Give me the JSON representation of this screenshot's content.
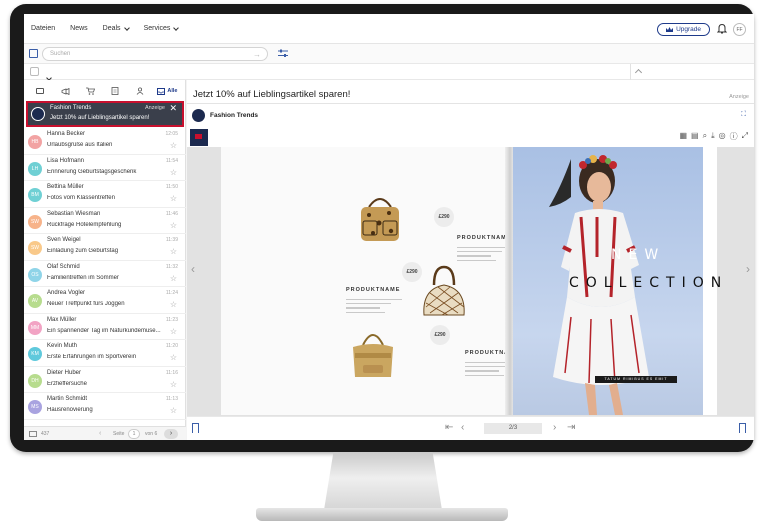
{
  "topnav": {
    "items": [
      {
        "label": "Dateien",
        "has_menu": false
      },
      {
        "label": "News",
        "has_menu": false
      },
      {
        "label": "Deals",
        "has_menu": true
      },
      {
        "label": "Services",
        "has_menu": true
      }
    ],
    "upgrade_label": "Upgrade",
    "user_initials": "FF"
  },
  "search": {
    "placeholder": "Suchen"
  },
  "list_tabs": {
    "all_label": "Alle"
  },
  "selected_ad": {
    "name": "Fashion Trends",
    "tag": "Anzeige",
    "subject": "Jetzt 10% auf Lieblingsartikel sparen!"
  },
  "mails": [
    {
      "initials": "HB",
      "name": "Hanna Becker",
      "subject": "Urlaubsgrüße aus Italien",
      "time": "12:05",
      "color": "#f2a3a3"
    },
    {
      "initials": "LH",
      "name": "Lisa Hofmann",
      "subject": "Erinnerung Geburtstagsgeschenk",
      "time": "11:54",
      "color": "#6fd0d4"
    },
    {
      "initials": "BM",
      "name": "Bettina Müller",
      "subject": "Fotos vom Klassentreffen",
      "time": "11:50",
      "color": "#6fd0d4"
    },
    {
      "initials": "SW",
      "name": "Sebastian Wiesman",
      "subject": "Rückfrage Hotelempfehlung",
      "time": "11:46",
      "color": "#f7b38a"
    },
    {
      "initials": "SW",
      "name": "Sven Weigel",
      "subject": "Einladung zum Geburtstag",
      "time": "11:39",
      "color": "#f9c98a"
    },
    {
      "initials": "OS",
      "name": "Olaf Schmid",
      "subject": "Familientreffen im Sommer",
      "time": "11:32",
      "color": "#8fd4e8"
    },
    {
      "initials": "AV",
      "name": "Andrea Vogler",
      "subject": "Neuer Treffpunkt fürs Joggen",
      "time": "11:24",
      "color": "#b7dc8e"
    },
    {
      "initials": "MM",
      "name": "Max Müller",
      "subject": "Ein spannender Tag im Naturkundemuse...",
      "time": "11:23",
      "color": "#f2a3c4"
    },
    {
      "initials": "KM",
      "name": "Kevin Muth",
      "subject": "Erste Erfahrungen im Sportverein",
      "time": "11:20",
      "color": "#5fc9dc"
    },
    {
      "initials": "DH",
      "name": "Dieter Huber",
      "subject": "Erzfieffersuche",
      "time": "11:16",
      "color": "#b7dc8e"
    },
    {
      "initials": "MS",
      "name": "Martin Schmidt",
      "subject": "Hausrenovierung",
      "time": "11:13",
      "color": "#a9a3e0"
    }
  ],
  "pager": {
    "count": "437",
    "seite_label": "Seite",
    "page": "1",
    "von_label": "von 6"
  },
  "ad_panel": {
    "title": "Jetzt 10% auf Lieblingsartikel sparen!",
    "tag": "Anzeige",
    "brand": "Fashion Trends"
  },
  "catalog": {
    "products": [
      {
        "price": "£290",
        "name": "PRODUKTNAME"
      },
      {
        "price": "£290",
        "name": "PRODUKTNAME"
      },
      {
        "price": "£290",
        "name": "PRODUKTNAME"
      }
    ],
    "headline_line1": "NEW",
    "headline_line2": "COLLECTION",
    "tagline": "TATUM RIMIBUS ES EMIT",
    "page_indicator": "2/3"
  },
  "colors": {
    "brand_navy": "#1c2a4f",
    "accent_blue": "#1e3a8a",
    "selection_red": "#c8102e"
  }
}
